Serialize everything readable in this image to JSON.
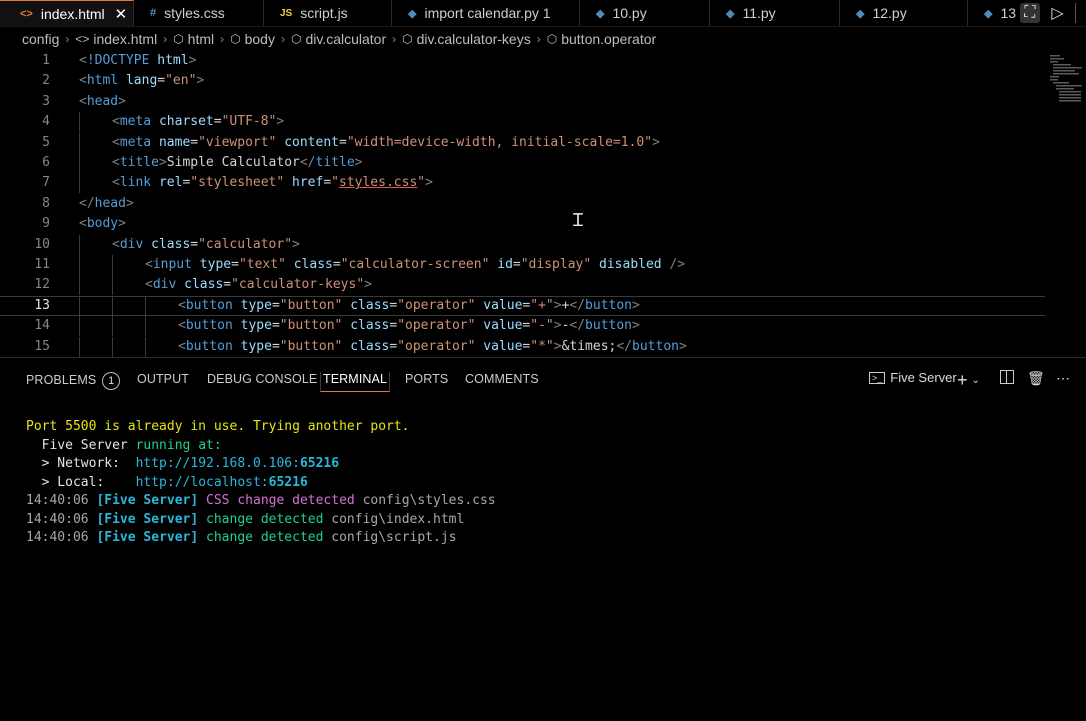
{
  "tabs": [
    {
      "label": "index.html",
      "icon": "html-file-icon",
      "active": true,
      "closable": true
    },
    {
      "label": "styles.css",
      "icon": "css-file-icon"
    },
    {
      "label": "script.js",
      "icon": "js-file-icon"
    },
    {
      "label": "import calendar.py 1",
      "icon": "python-file-icon"
    },
    {
      "label": "10.py",
      "icon": "python-file-icon"
    },
    {
      "label": "11.py",
      "icon": "python-file-icon"
    },
    {
      "label": "12.py",
      "icon": "python-file-icon"
    },
    {
      "label": "13",
      "icon": "python-file-icon"
    }
  ],
  "tab_icons": {
    "html": "<>",
    "css": "#",
    "js": "JS",
    "py": "◆",
    "close": "✕"
  },
  "breadcrumb": [
    {
      "label": "config",
      "icon": ""
    },
    {
      "label": "index.html",
      "icon": "<>"
    },
    {
      "label": "html",
      "icon": "⬡"
    },
    {
      "label": "body",
      "icon": "⬡"
    },
    {
      "label": "div.calculator",
      "icon": "⬡"
    },
    {
      "label": "div.calculator-keys",
      "icon": "⬡"
    },
    {
      "label": "button.operator",
      "icon": "⬡"
    }
  ],
  "editor": {
    "current_line": 13,
    "lines": [
      {
        "n": "1",
        "indent": 0,
        "tokens": [
          [
            "tag",
            "<"
          ],
          [
            "name",
            "!DOCTYPE "
          ],
          [
            "attr",
            "html"
          ],
          [
            "tag",
            ">"
          ]
        ]
      },
      {
        "n": "2",
        "indent": 0,
        "tokens": [
          [
            "tag",
            "<"
          ],
          [
            "name",
            "html "
          ],
          [
            "attr",
            "lang"
          ],
          [
            "text",
            "="
          ],
          [
            "str",
            "\"en\""
          ],
          [
            "tag",
            ">"
          ]
        ]
      },
      {
        "n": "3",
        "indent": 0,
        "tokens": [
          [
            "tag",
            "<"
          ],
          [
            "name",
            "head"
          ],
          [
            "tag",
            ">"
          ]
        ]
      },
      {
        "n": "4",
        "indent": 1,
        "tokens": [
          [
            "tag",
            "<"
          ],
          [
            "name",
            "meta "
          ],
          [
            "attr",
            "charset"
          ],
          [
            "text",
            "="
          ],
          [
            "str",
            "\"UTF-8\""
          ],
          [
            "tag",
            ">"
          ]
        ]
      },
      {
        "n": "5",
        "indent": 1,
        "tokens": [
          [
            "tag",
            "<"
          ],
          [
            "name",
            "meta "
          ],
          [
            "attr",
            "name"
          ],
          [
            "text",
            "="
          ],
          [
            "str",
            "\"viewport\" "
          ],
          [
            "attr",
            "content"
          ],
          [
            "text",
            "="
          ],
          [
            "str",
            "\"width=device-width, initial-scale=1.0\""
          ],
          [
            "tag",
            ">"
          ]
        ]
      },
      {
        "n": "6",
        "indent": 1,
        "tokens": [
          [
            "tag",
            "<"
          ],
          [
            "name",
            "title"
          ],
          [
            "tag",
            ">"
          ],
          [
            "text",
            "Simple Calculator"
          ],
          [
            "tag",
            "</"
          ],
          [
            "name",
            "title"
          ],
          [
            "tag",
            ">"
          ]
        ]
      },
      {
        "n": "7",
        "indent": 1,
        "tokens": [
          [
            "tag",
            "<"
          ],
          [
            "name",
            "link "
          ],
          [
            "attr",
            "rel"
          ],
          [
            "text",
            "="
          ],
          [
            "str",
            "\"stylesheet\" "
          ],
          [
            "attr",
            "href"
          ],
          [
            "text",
            "="
          ],
          [
            "str",
            "\""
          ],
          [
            "strlink",
            "styles.css"
          ],
          [
            "str",
            "\""
          ],
          [
            "tag",
            ">"
          ]
        ]
      },
      {
        "n": "8",
        "indent": 0,
        "tokens": [
          [
            "tag",
            "</"
          ],
          [
            "name",
            "head"
          ],
          [
            "tag",
            ">"
          ]
        ]
      },
      {
        "n": "9",
        "indent": 0,
        "tokens": [
          [
            "tag",
            "<"
          ],
          [
            "name",
            "body"
          ],
          [
            "tag",
            ">"
          ]
        ]
      },
      {
        "n": "10",
        "indent": 1,
        "tokens": [
          [
            "tag",
            "<"
          ],
          [
            "name",
            "div "
          ],
          [
            "attr",
            "class"
          ],
          [
            "text",
            "="
          ],
          [
            "str",
            "\"calculator\""
          ],
          [
            "tag",
            ">"
          ]
        ]
      },
      {
        "n": "11",
        "indent": 2,
        "tokens": [
          [
            "tag",
            "<"
          ],
          [
            "name",
            "input "
          ],
          [
            "attr",
            "type"
          ],
          [
            "text",
            "="
          ],
          [
            "str",
            "\"text\" "
          ],
          [
            "attr",
            "class"
          ],
          [
            "text",
            "="
          ],
          [
            "str",
            "\"calculator-screen\" "
          ],
          [
            "attr",
            "id"
          ],
          [
            "text",
            "="
          ],
          [
            "str",
            "\"display\" "
          ],
          [
            "attr",
            "disabled "
          ],
          [
            "tag",
            "/>"
          ]
        ]
      },
      {
        "n": "12",
        "indent": 2,
        "tokens": [
          [
            "tag",
            "<"
          ],
          [
            "name",
            "div "
          ],
          [
            "attr",
            "class"
          ],
          [
            "text",
            "="
          ],
          [
            "str",
            "\"calculator-keys\""
          ],
          [
            "tag",
            ">"
          ]
        ]
      },
      {
        "n": "13",
        "indent": 3,
        "tokens": [
          [
            "tag",
            "<"
          ],
          [
            "name",
            "button "
          ],
          [
            "attr",
            "type"
          ],
          [
            "text",
            "="
          ],
          [
            "str",
            "\"button\" "
          ],
          [
            "attr",
            "class"
          ],
          [
            "text",
            "="
          ],
          [
            "str",
            "\"operator\" "
          ],
          [
            "attr",
            "value"
          ],
          [
            "text",
            "="
          ],
          [
            "str",
            "\"+\""
          ],
          [
            "tag",
            ">"
          ],
          [
            "text",
            "+"
          ],
          [
            "tag",
            "</"
          ],
          [
            "name",
            "button"
          ],
          [
            "tag",
            ">"
          ]
        ]
      },
      {
        "n": "14",
        "indent": 3,
        "tokens": [
          [
            "tag",
            "<"
          ],
          [
            "name",
            "button "
          ],
          [
            "attr",
            "type"
          ],
          [
            "text",
            "="
          ],
          [
            "str",
            "\"button\" "
          ],
          [
            "attr",
            "class"
          ],
          [
            "text",
            "="
          ],
          [
            "str",
            "\"operator\" "
          ],
          [
            "attr",
            "value"
          ],
          [
            "text",
            "="
          ],
          [
            "str",
            "\"-\""
          ],
          [
            "tag",
            ">"
          ],
          [
            "text",
            "-"
          ],
          [
            "tag",
            "</"
          ],
          [
            "name",
            "button"
          ],
          [
            "tag",
            ">"
          ]
        ]
      },
      {
        "n": "15",
        "indent": 3,
        "tokens": [
          [
            "tag",
            "<"
          ],
          [
            "name",
            "button "
          ],
          [
            "attr",
            "type"
          ],
          [
            "text",
            "="
          ],
          [
            "str",
            "\"button\" "
          ],
          [
            "attr",
            "class"
          ],
          [
            "text",
            "="
          ],
          [
            "str",
            "\"operator\" "
          ],
          [
            "attr",
            "value"
          ],
          [
            "text",
            "="
          ],
          [
            "str",
            "\"*\""
          ],
          [
            "tag",
            ">"
          ],
          [
            "text",
            "&times;"
          ],
          [
            "tag",
            "</"
          ],
          [
            "name",
            "button"
          ],
          [
            "tag",
            ">"
          ]
        ]
      }
    ]
  },
  "panel": {
    "tabs": [
      {
        "label": "PROBLEMS",
        "badge": "1"
      },
      {
        "label": "OUTPUT"
      },
      {
        "label": "DEBUG CONSOLE"
      },
      {
        "label": "TERMINAL",
        "active": true
      },
      {
        "label": "PORTS"
      },
      {
        "label": "COMMENTS"
      }
    ],
    "terminal_name": "Five Server",
    "terminal": [
      [
        [
          "yellow",
          "Port 5500 is already in use. Trying another port."
        ]
      ],
      [
        [
          "white",
          "  Five Server "
        ],
        [
          "green",
          "running at:"
        ]
      ],
      [
        [
          "white",
          "  > Network:  "
        ],
        [
          "cyan",
          "http://192.168.0.106:"
        ],
        [
          "bcyan",
          "65216"
        ]
      ],
      [
        [
          "white",
          "  > Local:    "
        ],
        [
          "cyan",
          "http://localhost:"
        ],
        [
          "bcyan",
          "65216"
        ]
      ],
      [
        [
          "gray",
          "14:40:06 "
        ],
        [
          "bcyan",
          "[Five Server] "
        ],
        [
          "magenta",
          "CSS change detected "
        ],
        [
          "gray",
          "config\\styles.css"
        ]
      ],
      [
        [
          "gray",
          "14:40:06 "
        ],
        [
          "bcyan",
          "[Five Server] "
        ],
        [
          "green",
          "change detected "
        ],
        [
          "gray",
          "config\\index.html"
        ]
      ],
      [
        [
          "gray",
          "14:40:06 "
        ],
        [
          "bcyan",
          "[Five Server] "
        ],
        [
          "green",
          "change detected "
        ],
        [
          "gray",
          "config\\script.js"
        ]
      ]
    ]
  }
}
